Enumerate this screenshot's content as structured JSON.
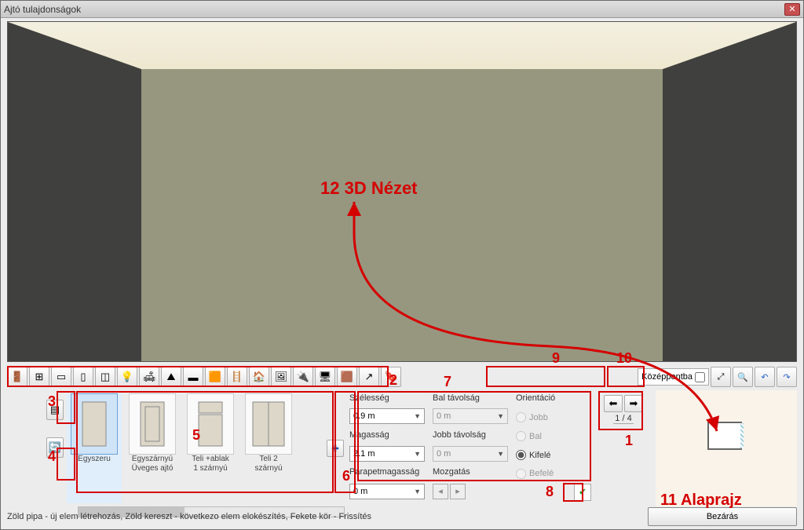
{
  "window": {
    "title": "Ajtó tulajdonságok"
  },
  "annotations": {
    "a1": "1",
    "a2": "2",
    "a3": "3",
    "a4": "4",
    "a5": "5",
    "a6": "6",
    "a7": "7",
    "a8": "8",
    "a9": "9",
    "a10": "10",
    "view3d": "12 3D Nézet",
    "plan": "11 Alaprajz"
  },
  "zoom": {
    "center_label": "Középpontba"
  },
  "gallery": {
    "items": [
      {
        "line1": "Egyszeru",
        "line2": ""
      },
      {
        "line1": "Egyszárnyú",
        "line2": "Üveges ajtó"
      },
      {
        "line1": "Teli +ablak",
        "line2": "1 szárnyú"
      },
      {
        "line1": "Teli 2",
        "line2": "szárnyú"
      }
    ]
  },
  "props": {
    "width_label": "Szélesség",
    "width_value": "0.9 m",
    "height_label": "Magasság",
    "height_value": "2.1 m",
    "parapet_label": "Parapetmagasság",
    "parapet_value": "0 m",
    "leftdist_label": "Bal távolság",
    "leftdist_value": "0 m",
    "rightdist_label": "Jobb távolság",
    "rightdist_value": "0 m",
    "move_label": "Mozgatás",
    "orient_label": "Orientáció",
    "orient_jobb": "Jobb",
    "orient_bal": "Bal",
    "orient_kifele": "Kifelé",
    "orient_befele": "Befelé"
  },
  "paging": {
    "counter": "1 / 4"
  },
  "footer": {
    "hint": "Zöld pipa - új elem létrehozás, Zöld kereszt - következo elem elokészítés, Fekete kör - Frissítés",
    "close": "Bezárás"
  },
  "icons": {
    "close_x": "✕",
    "plus": "✚",
    "check": "✔",
    "undo": "↶",
    "redo": "↷",
    "zoom_fit": "⤢",
    "zoom_in": "🔍",
    "step_left": "◂",
    "step_right": "▸"
  }
}
